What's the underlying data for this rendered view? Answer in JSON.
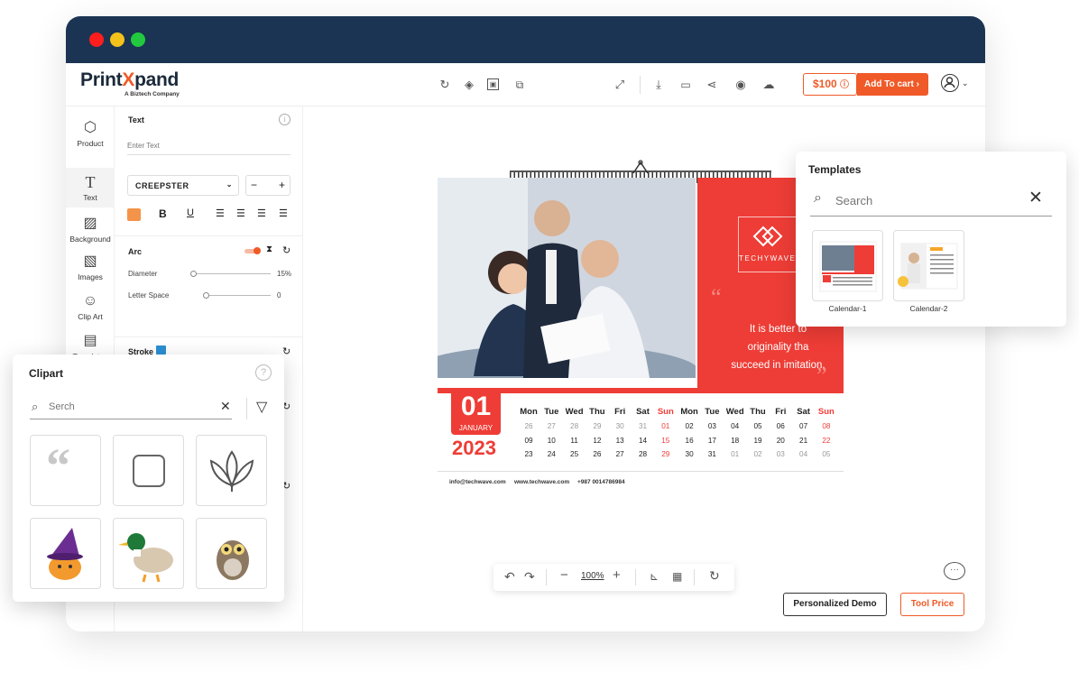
{
  "brand": {
    "logo_main": "Print",
    "logo_x": "X",
    "logo_rest": "pand",
    "logo_sub": "A Biztech Company"
  },
  "toolbar": {
    "price": "$100",
    "price_icon": "info-icon",
    "add_to_cart": "Add To cart"
  },
  "sidebar": {
    "items": [
      {
        "label": "Product",
        "icon": "box-icon"
      },
      {
        "label": "Text",
        "icon": "text-icon"
      },
      {
        "label": "Background",
        "icon": "background-icon"
      },
      {
        "label": "Images",
        "icon": "image-icon"
      },
      {
        "label": "Clip Art",
        "icon": "clipart-icon"
      },
      {
        "label": "Templates",
        "icon": "template-icon"
      }
    ]
  },
  "text_panel": {
    "title": "Text",
    "placeholder": "Enter Text",
    "font": "CREEPSTER",
    "arc_label": "Arc",
    "diameter_label": "Diameter",
    "diameter_value": "15%",
    "letter_space_label": "Letter Space",
    "letter_space_value": "0",
    "stroke_label": "Stroke",
    "accent": "#f4934a"
  },
  "calendar": {
    "brand": "TECHYWAVE",
    "quote": [
      "It is better to",
      "originality tha",
      "succeed in imitation."
    ],
    "day": "01",
    "month": "JANUARY",
    "year": "2023",
    "weekdays": [
      "Mon",
      "Tue",
      "Wed",
      "Thu",
      "Fri",
      "Sat",
      "Sun",
      "Mon",
      "Tue",
      "Wed",
      "Thu",
      "Fri",
      "Sat",
      "Sun"
    ],
    "rows": [
      [
        "26",
        "27",
        "28",
        "29",
        "30",
        "31",
        "01",
        "02",
        "03",
        "04",
        "05",
        "06",
        "07",
        "08"
      ],
      [
        "09",
        "10",
        "11",
        "12",
        "13",
        "14",
        "15",
        "16",
        "17",
        "18",
        "19",
        "20",
        "21",
        "22"
      ],
      [
        "23",
        "24",
        "25",
        "26",
        "27",
        "28",
        "29",
        "30",
        "31",
        "01",
        "02",
        "03",
        "04",
        "05"
      ]
    ],
    "footer": [
      "info@techwave.com",
      "www.techwave.com",
      "+987 0014786984"
    ]
  },
  "zoom": {
    "value": "100%"
  },
  "buttons": {
    "demo": "Personalized Demo",
    "tool_price": "Tool Price"
  },
  "clipart": {
    "title": "Clipart",
    "search_placeholder": "Serch"
  },
  "templates": {
    "title": "Templates",
    "search_placeholder": "Search",
    "items": [
      "Calendar-1",
      "Calendar-2"
    ]
  },
  "colors": {
    "brand_orange": "#f05a28",
    "calendar_red": "#ee3d36",
    "titlebar": "#1b3453"
  }
}
